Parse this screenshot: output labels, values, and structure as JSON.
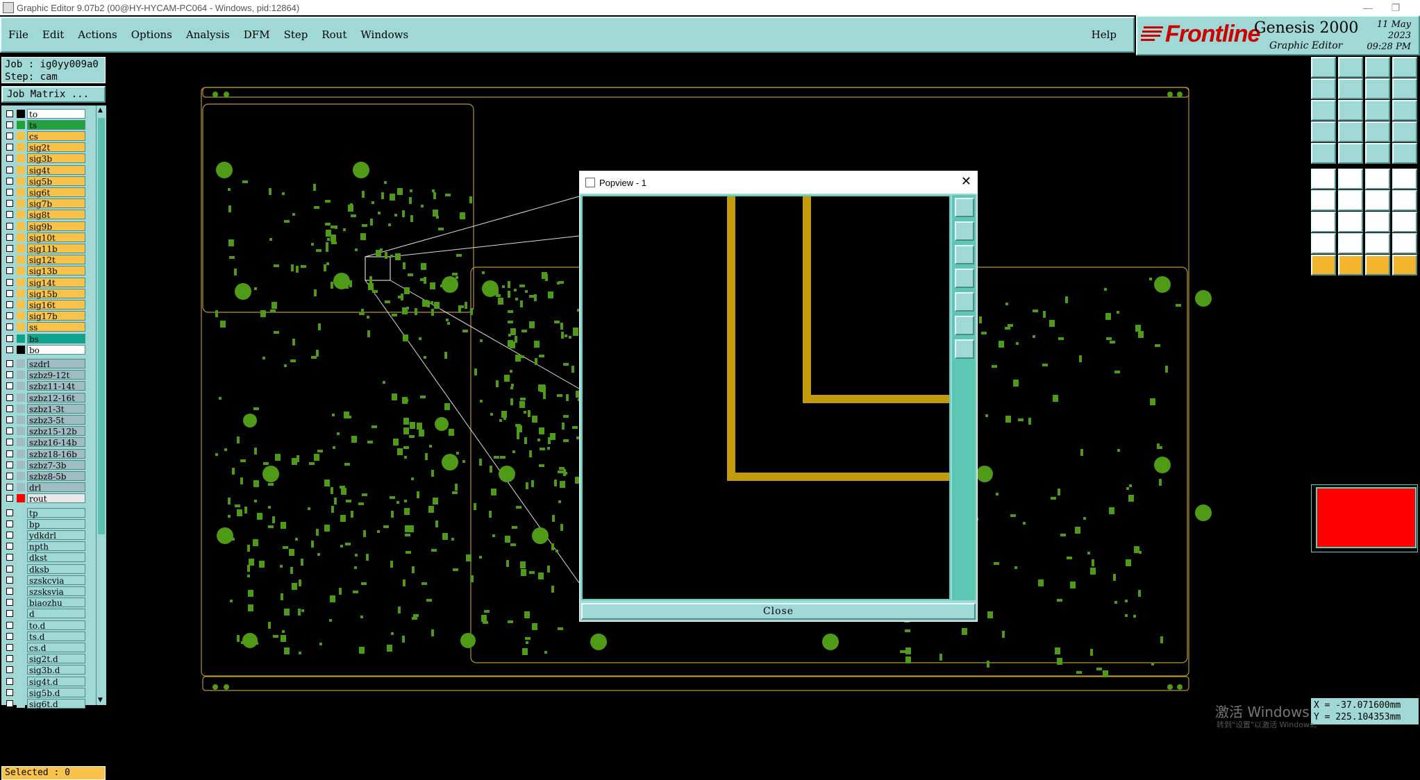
{
  "window": {
    "title": "Graphic Editor 9.07b2 (00@HY-HYCAM-PC064 - Windows, pid:12864)"
  },
  "menu": {
    "items": [
      "File",
      "Edit",
      "Actions",
      "Options",
      "Analysis",
      "DFM",
      "Step",
      "Rout",
      "Windows"
    ],
    "help": "Help"
  },
  "brand": {
    "logo": "Frontline",
    "product": "Genesis 2000",
    "subtitle": "Graphic Editor",
    "date": "11 May 2023",
    "time": "09:28 PM"
  },
  "job": {
    "job_line": "Job : ig0yy009a0",
    "step_line": "Step: cam",
    "matrix_button": "Job Matrix ..."
  },
  "layers": [
    {
      "name": "to",
      "color": "#000000",
      "bg": "#ffffff"
    },
    {
      "name": "ts",
      "color": "#23a13f",
      "bg": "#23a13f"
    },
    {
      "name": "cs",
      "color": "#f9c34a",
      "bg": "#f9c34a"
    },
    {
      "name": "sig2t",
      "color": "#f9c34a",
      "bg": "#f9c34a"
    },
    {
      "name": "sig3b",
      "color": "#f9c34a",
      "bg": "#f9c34a"
    },
    {
      "name": "sig4t",
      "color": "#f9c34a",
      "bg": "#f9c34a"
    },
    {
      "name": "sig5b",
      "color": "#f9c34a",
      "bg": "#f9c34a"
    },
    {
      "name": "sig6t",
      "color": "#f9c34a",
      "bg": "#f9c34a"
    },
    {
      "name": "sig7b",
      "color": "#f9c34a",
      "bg": "#f9c34a"
    },
    {
      "name": "sig8t",
      "color": "#f9c34a",
      "bg": "#f9c34a"
    },
    {
      "name": "sig9b",
      "color": "#f9c34a",
      "bg": "#f9c34a"
    },
    {
      "name": "sig10t",
      "color": "#f9c34a",
      "bg": "#f9c34a"
    },
    {
      "name": "sig11b",
      "color": "#f9c34a",
      "bg": "#f9c34a"
    },
    {
      "name": "sig12t",
      "color": "#f9c34a",
      "bg": "#f9c34a"
    },
    {
      "name": "sig13b",
      "color": "#f9c34a",
      "bg": "#f9c34a"
    },
    {
      "name": "sig14t",
      "color": "#f9c34a",
      "bg": "#f9c34a"
    },
    {
      "name": "sig15b",
      "color": "#f9c34a",
      "bg": "#f9c34a"
    },
    {
      "name": "sig16t",
      "color": "#f9c34a",
      "bg": "#f9c34a"
    },
    {
      "name": "sig17b",
      "color": "#f9c34a",
      "bg": "#f9c34a"
    },
    {
      "name": "ss",
      "color": "#f9c34a",
      "bg": "#f9c34a"
    },
    {
      "name": "bs",
      "color": "#0ea58e",
      "bg": "#0ea58e"
    },
    {
      "name": "bo",
      "color": "#000000",
      "bg": "#ffffff"
    },
    {
      "name": "szdrl",
      "color": "#9fbcc0",
      "bg": "#9fbcc0"
    },
    {
      "name": "szbz9-12t",
      "color": "#9fbcc0",
      "bg": "#9fbcc0"
    },
    {
      "name": "szbz11-14t",
      "color": "#9fbcc0",
      "bg": "#9fbcc0"
    },
    {
      "name": "szbz12-16t",
      "color": "#9fbcc0",
      "bg": "#9fbcc0"
    },
    {
      "name": "szbz1-3t",
      "color": "#9fbcc0",
      "bg": "#9fbcc0"
    },
    {
      "name": "szbz3-5t",
      "color": "#9fbcc0",
      "bg": "#9fbcc0"
    },
    {
      "name": "szbz15-12b",
      "color": "#9fbcc0",
      "bg": "#9fbcc0"
    },
    {
      "name": "szbz16-14b",
      "color": "#9fbcc0",
      "bg": "#9fbcc0"
    },
    {
      "name": "szbz18-16b",
      "color": "#9fbcc0",
      "bg": "#9fbcc0"
    },
    {
      "name": "szbz7-3b",
      "color": "#9fbcc0",
      "bg": "#9fbcc0"
    },
    {
      "name": "szbz8-5b",
      "color": "#9fbcc0",
      "bg": "#9fbcc0"
    },
    {
      "name": "drl",
      "color": "#9fbcc0",
      "bg": "#9fbcc0"
    },
    {
      "name": "rout",
      "color": "#ff0000",
      "bg": "#e8e8e8"
    },
    {
      "name": "tp",
      "color": "#9fd8d4",
      "bg": "#9fd8d4"
    },
    {
      "name": "bp",
      "color": "#9fd8d4",
      "bg": "#9fd8d4"
    },
    {
      "name": "ydkdrl",
      "color": "#9fd8d4",
      "bg": "#9fd8d4"
    },
    {
      "name": "npth",
      "color": "#9fd8d4",
      "bg": "#9fd8d4"
    },
    {
      "name": "dkst",
      "color": "#9fd8d4",
      "bg": "#9fd8d4"
    },
    {
      "name": "dksb",
      "color": "#9fd8d4",
      "bg": "#9fd8d4"
    },
    {
      "name": "szskcvia",
      "color": "#9fd8d4",
      "bg": "#9fd8d4"
    },
    {
      "name": "szsksvia",
      "color": "#9fd8d4",
      "bg": "#9fd8d4"
    },
    {
      "name": "biaozhu",
      "color": "#9fd8d4",
      "bg": "#9fd8d4"
    },
    {
      "name": "d",
      "color": "#9fd8d4",
      "bg": "#9fd8d4"
    },
    {
      "name": "to.d",
      "color": "#9fd8d4",
      "bg": "#9fd8d4"
    },
    {
      "name": "ts.d",
      "color": "#9fd8d4",
      "bg": "#9fd8d4"
    },
    {
      "name": "cs.d",
      "color": "#9fd8d4",
      "bg": "#9fd8d4"
    },
    {
      "name": "sig2t.d",
      "color": "#9fd8d4",
      "bg": "#9fd8d4"
    },
    {
      "name": "sig3b.d",
      "color": "#9fd8d4",
      "bg": "#9fd8d4"
    },
    {
      "name": "sig4t.d",
      "color": "#9fd8d4",
      "bg": "#9fd8d4"
    },
    {
      "name": "sig5b.d",
      "color": "#9fd8d4",
      "bg": "#9fd8d4"
    },
    {
      "name": "sig6t.d",
      "color": "#9fd8d4",
      "bg": "#9fd8d4"
    }
  ],
  "status": {
    "selected": "Selected : 0"
  },
  "popview": {
    "title": "Popview - 1",
    "close_label": "Close"
  },
  "coords": {
    "x": "X = -37.071600mm",
    "y": "Y = 225.104353mm"
  },
  "watermark": {
    "line1": "激活 Windows",
    "line2": "转到\"设置\"以激活 Windows。"
  }
}
